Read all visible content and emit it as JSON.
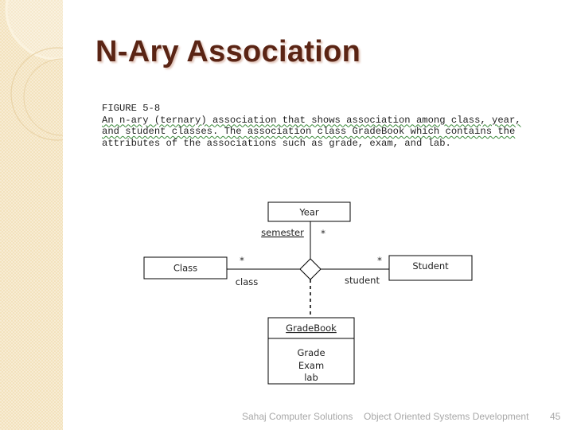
{
  "slide": {
    "title": "N-Ary Association",
    "figure_caption": {
      "label": "FIGURE 5-8",
      "lines": [
        "An n-ary (ternary) association that shows association among class, year,",
        "and student classes. The association class GradeBook which contains the",
        "attributes of the associations such as grade, exam, and lab."
      ]
    },
    "diagram": {
      "classes": {
        "year": "Year",
        "class": "Class",
        "student": "Student"
      },
      "association_class": {
        "name": "GradeBook",
        "attributes": [
          "Grade",
          "Exam",
          "lab"
        ]
      },
      "roles": {
        "year_role": "semester",
        "year_multiplicity": "*",
        "class_role": "class",
        "class_multiplicity": "*",
        "student_role": "student",
        "student_multiplicity": "*"
      }
    },
    "footer": {
      "organization": "Sahaj Computer Solutions",
      "course": "Object Oriented Systems Development",
      "page_number": "45"
    },
    "colors": {
      "title": "#5a2414",
      "sidebar": "#f3e2bd",
      "footer_text": "#a8a8a8"
    }
  }
}
